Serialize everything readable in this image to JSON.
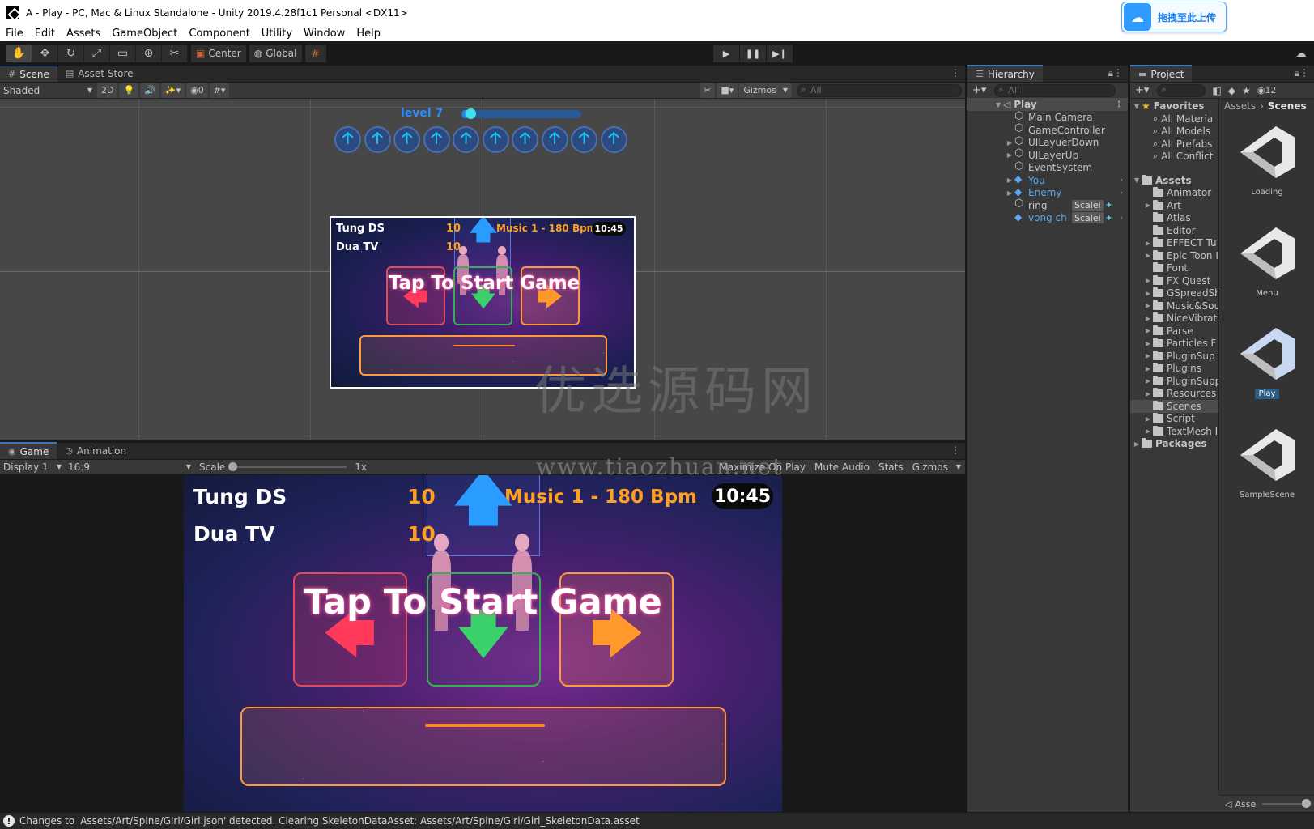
{
  "window": {
    "title": "A - Play - PC, Mac & Linux Standalone - Unity 2019.4.28f1c1 Personal <DX11>",
    "upload_label": "拖拽至此上传"
  },
  "menu": [
    "File",
    "Edit",
    "Assets",
    "GameObject",
    "Component",
    "Utility",
    "Window",
    "Help"
  ],
  "toolbar": {
    "pivot": "Center",
    "space": "Global"
  },
  "scene": {
    "tabs": [
      "Scene",
      "Asset Store"
    ],
    "shading": "Shaded",
    "mode_2d": "2D",
    "hidden_count": "0",
    "gizmos": "Gizmos",
    "search_placeholder": "All",
    "level_label": "level 7",
    "level_progress": 0.06
  },
  "game": {
    "tabs": [
      "Game",
      "Animation"
    ],
    "display": "Display 1",
    "aspect": "16:9",
    "scale_label": "Scale",
    "scale_value": "1x",
    "maximize": "Maximize On Play",
    "mute": "Mute Audio",
    "stats": "Stats",
    "gizmos": "Gizmos"
  },
  "gameplay": {
    "player1": "Tung DS",
    "player2": "Dua TV",
    "score1": "10",
    "score2": "10",
    "music": "Music 1 - 180 Bpm",
    "time": "10:45",
    "tap": "Tap To Start Game"
  },
  "hierarchy": {
    "tab": "Hierarchy",
    "search_placeholder": "All",
    "scene": "Play",
    "items": [
      {
        "label": "Main Camera",
        "type": "obj"
      },
      {
        "label": "GameController",
        "type": "obj"
      },
      {
        "label": "UILayuerDown",
        "type": "obj",
        "fold": true
      },
      {
        "label": "UILayerUp",
        "type": "obj",
        "fold": true
      },
      {
        "label": "EventSystem",
        "type": "obj"
      },
      {
        "label": "You",
        "type": "prefab",
        "fold": true
      },
      {
        "label": "Enemy",
        "type": "prefab",
        "fold": true
      },
      {
        "label": "ring",
        "type": "obj",
        "tag": "Scalei"
      },
      {
        "label": "vong ch",
        "type": "prefab",
        "tag": "Scalei"
      }
    ]
  },
  "project": {
    "tab": "Project",
    "hidden_count": "12",
    "favorites_label": "Favorites",
    "favorites": [
      "All Materia",
      "All Models",
      "All Prefabs",
      "All Conflict"
    ],
    "assets_label": "Assets",
    "folders": [
      {
        "label": "Animator",
        "fold": false
      },
      {
        "label": "Art",
        "fold": true
      },
      {
        "label": "Atlas",
        "fold": false
      },
      {
        "label": "Editor",
        "fold": false
      },
      {
        "label": "EFFECT Tu",
        "fold": true
      },
      {
        "label": "Epic Toon I",
        "fold": true
      },
      {
        "label": "Font",
        "fold": false
      },
      {
        "label": "FX Quest",
        "fold": true
      },
      {
        "label": "GSpreadSh",
        "fold": true
      },
      {
        "label": "Music&Sou",
        "fold": true
      },
      {
        "label": "NiceVibrati",
        "fold": true
      },
      {
        "label": "Parse",
        "fold": true
      },
      {
        "label": "Particles F",
        "fold": true
      },
      {
        "label": "PluginSup",
        "fold": true
      },
      {
        "label": "Plugins",
        "fold": true
      },
      {
        "label": "PluginSupp",
        "fold": true
      },
      {
        "label": "Resources",
        "fold": true
      },
      {
        "label": "Scenes",
        "fold": false,
        "selected": true
      },
      {
        "label": "Script",
        "fold": true
      },
      {
        "label": "TextMesh I",
        "fold": true
      }
    ],
    "packages_label": "Packages",
    "breadcrumb_root": "Assets",
    "breadcrumb_current": "Scenes",
    "scenes": [
      "Loading",
      "Menu",
      "Play",
      "SampleScene"
    ],
    "selected_scene": "Play",
    "footer_label": "Asse"
  },
  "status": {
    "message": "Changes to 'Assets/Art/Spine/Girl/Girl.json' detected. Clearing SkeletonDataAsset: Assets/Art/Spine/Girl/Girl_SkeletonData.asset"
  },
  "watermark": {
    "line1": "优选源码网",
    "line2": "www.tiaozhuan.net"
  },
  "colors": {
    "accent": "#3a79bb",
    "prefab": "#56a8f0",
    "score": "#ffa020",
    "level": "#2d8eff"
  }
}
